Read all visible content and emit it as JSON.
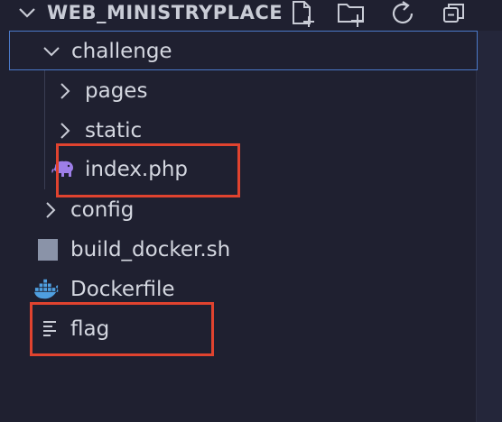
{
  "explorer": {
    "project_title": "WEB_MINISTRYPLACE",
    "actions": [
      {
        "name": "new-file-icon"
      },
      {
        "name": "new-folder-icon"
      },
      {
        "name": "refresh-icon"
      },
      {
        "name": "collapse-all-icon"
      }
    ]
  },
  "tree": {
    "challenge": "challenge",
    "pages": "pages",
    "static": "static",
    "index_php": "index.php",
    "config": "config",
    "build_docker": "build_docker.sh",
    "dockerfile": "Dockerfile",
    "flag": "flag"
  },
  "colors": {
    "background": "#1f2030",
    "text": "#d4d7e0",
    "selection_border": "#4b79c8",
    "annotation_box": "#e0432f",
    "php_icon": "#9d7ee8",
    "docker_icon": "#4f9fe0"
  }
}
